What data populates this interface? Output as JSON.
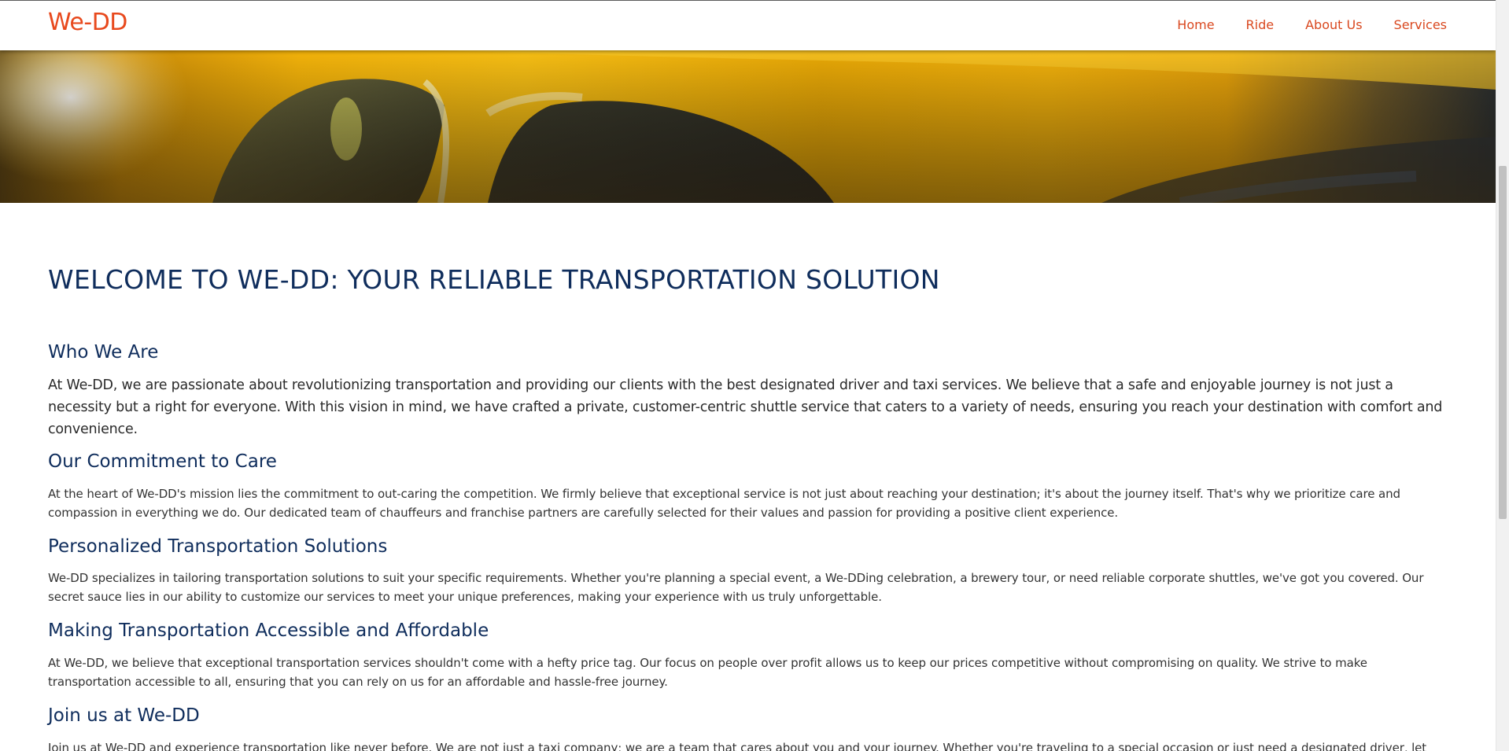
{
  "header": {
    "brand": "We-DD",
    "nav": [
      {
        "label": "Home"
      },
      {
        "label": "Ride"
      },
      {
        "label": "About Us"
      },
      {
        "label": "Services"
      }
    ]
  },
  "hero": {
    "image_icon": "yellow-taxi-image"
  },
  "main": {
    "title": "WELCOME TO WE-DD: YOUR RELIABLE TRANSPORTATION SOLUTION",
    "sections": [
      {
        "heading": "Who We Are",
        "text": "At We-DD, we are passionate about revolutionizing transportation and providing our clients with the best designated driver and taxi services. We believe that a safe and enjoyable journey is not just a necessity but a right for everyone. With this vision in mind, we have crafted a private, customer-centric shuttle service that caters to a variety of needs, ensuring you reach your destination with comfort and convenience."
      },
      {
        "heading": "Our Commitment to Care",
        "text": "At the heart of We-DD's mission lies the commitment to out-caring the competition. We firmly believe that exceptional service is not just about reaching your destination; it's about the journey itself. That's why we prioritize care and compassion in everything we do. Our dedicated team of chauffeurs and franchise partners are carefully selected for their values and passion for providing a positive client experience."
      },
      {
        "heading": "Personalized Transportation Solutions",
        "text": "We-DD specializes in tailoring transportation solutions to suit your specific requirements. Whether you're planning a special event, a We-DDing celebration, a brewery tour, or need reliable corporate shuttles, we've got you covered. Our secret sauce lies in our ability to customize our services to meet your unique preferences, making your experience with us truly unforgettable."
      },
      {
        "heading": "Making Transportation Accessible and Affordable",
        "text": "At We-DD, we believe that exceptional transportation services shouldn't come with a hefty price tag. Our focus on people over profit allows us to keep our prices competitive without compromising on quality. We strive to make transportation accessible to all, ensuring that you can rely on us for an affordable and hassle-free journey."
      },
      {
        "heading": "Join us at We-DD",
        "text": "Join us at We-DD and experience transportation like never before. We are not just a taxi company; we are a team that cares about you and your journey. Whether you're traveling to a special occasion or just need a designated driver, let We-DD"
      }
    ]
  },
  "colors": {
    "brand": "#e8491d",
    "nav": "#d9481f",
    "heading": "#0f2d5c",
    "body_text": "#333333"
  }
}
